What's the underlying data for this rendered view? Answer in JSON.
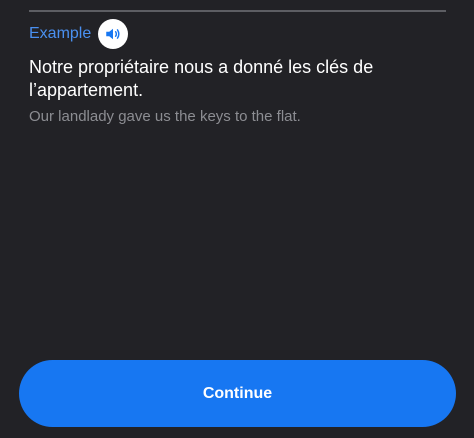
{
  "example": {
    "label": "Example",
    "audio_icon": "speaker-icon"
  },
  "sentence": {
    "french": "Notre propriétaire nous a donné les clés de l’appartement.",
    "english": "Our landlady gave us the keys to the flat."
  },
  "footer": {
    "continue_label": "Continue"
  },
  "colors": {
    "background": "#222226",
    "accent": "#4a90f0",
    "button": "#1777f2",
    "muted_text": "#8c8d92"
  }
}
